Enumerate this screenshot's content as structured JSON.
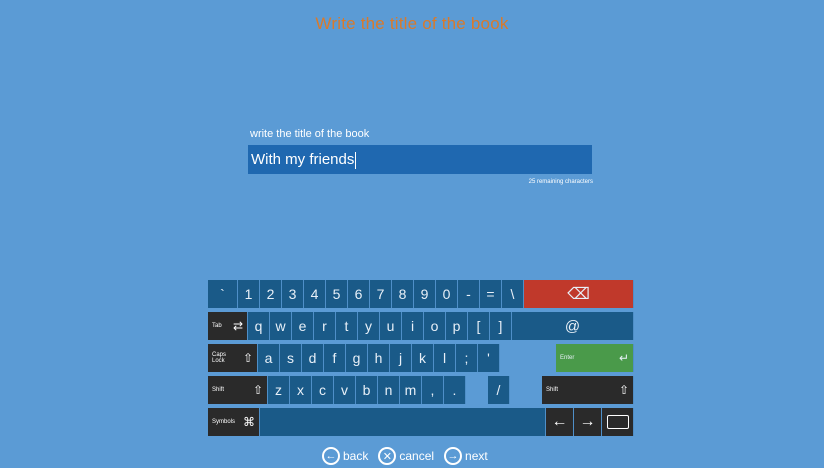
{
  "header": {
    "title": "Write the title of the book"
  },
  "form": {
    "label": "write the title of the book",
    "value": "With my friends",
    "remaining": "25 remaining characters"
  },
  "keyboard": {
    "row1": [
      "`",
      "1",
      "2",
      "3",
      "4",
      "5",
      "6",
      "7",
      "8",
      "9",
      "0",
      "-",
      "=",
      "\\"
    ],
    "backspace": "⌫",
    "row2": [
      "q",
      "w",
      "e",
      "r",
      "t",
      "y",
      "u",
      "i",
      "o",
      "p",
      "[",
      "]"
    ],
    "tab_label": "Tab",
    "at": "@",
    "row3": [
      "a",
      "s",
      "d",
      "f",
      "g",
      "h",
      "j",
      "k",
      "l",
      ";",
      "'"
    ],
    "caps_label": "Caps Lock",
    "enter_label": "Enter",
    "row4": [
      "z",
      "x",
      "c",
      "v",
      "b",
      "n",
      "m",
      ",",
      ".",
      "/"
    ],
    "shift_label": "Shift",
    "symbols_label": "Symbols",
    "left_arrow": "←",
    "right_arrow": "→"
  },
  "nav": {
    "back": "back",
    "cancel": "cancel",
    "next": "next"
  },
  "icons": {
    "back": "arrow-left-circle-icon",
    "cancel": "x-circle-icon",
    "next": "arrow-right-circle-icon"
  },
  "colors": {
    "background": "#5b9bd5",
    "title": "#d97a2b",
    "key": "#1a5a88",
    "dark_key": "#2a2a2a",
    "backspace": "#c0392b",
    "enter": "#4a9a4a"
  }
}
